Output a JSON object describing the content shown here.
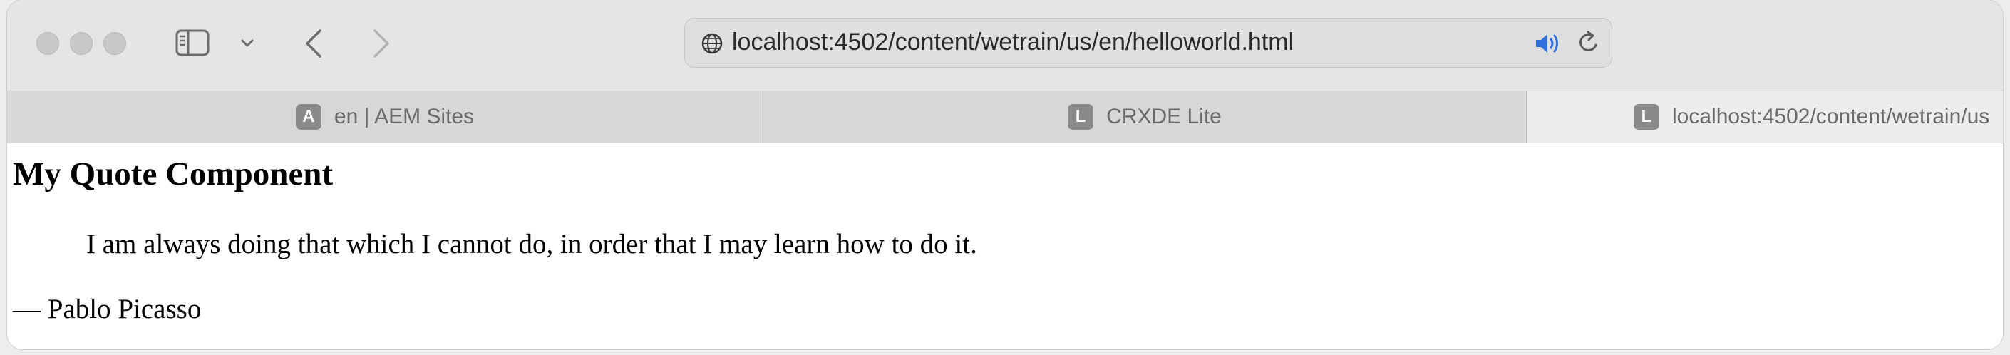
{
  "browser": {
    "address": {
      "url": "localhost:4502/content/wetrain/us/en/helloworld.html",
      "icon": "globe-icon"
    },
    "toolbar_icons": [
      "sidebar-icon",
      "chevron-down-icon",
      "back-icon",
      "forward-icon",
      "speaker-icon",
      "reload-icon"
    ],
    "tabs": [
      {
        "label": "en | AEM Sites",
        "favicon_letter": "A"
      },
      {
        "label": "CRXDE Lite",
        "favicon_letter": "L"
      },
      {
        "label": "localhost:4502/content/wetrain/us",
        "favicon_letter": "L"
      }
    ]
  },
  "page": {
    "title": "My Quote Component",
    "quote": "I am always doing that which I cannot do, in order that I may learn how to do it.",
    "author": "— Pablo Picasso"
  },
  "colors": {
    "accent_speaker": "#2f6fe0",
    "toolbar_bg": "#e6e5e6",
    "tabs_bg": "#d8d7d8"
  }
}
